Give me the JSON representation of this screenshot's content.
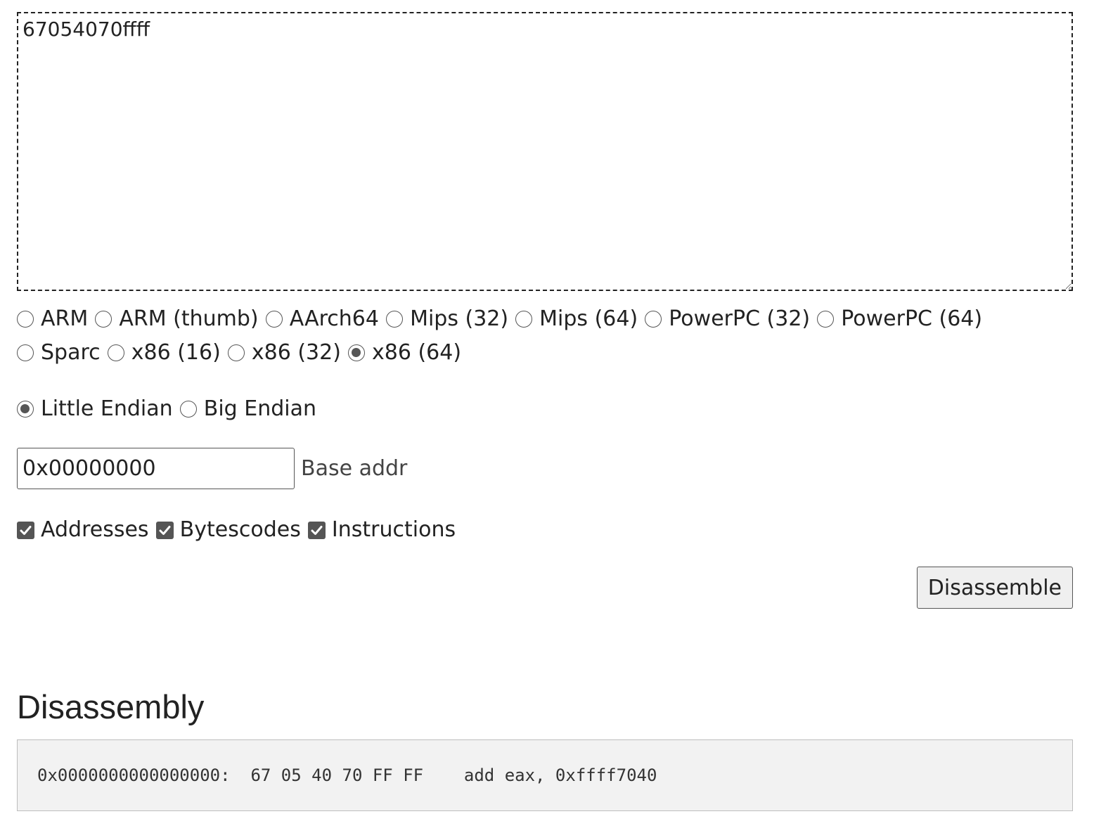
{
  "hex_input": {
    "value": "67054070ffff"
  },
  "architectures": [
    {
      "label": "ARM",
      "selected": false
    },
    {
      "label": "ARM (thumb)",
      "selected": false
    },
    {
      "label": "AArch64",
      "selected": false
    },
    {
      "label": "Mips (32)",
      "selected": false
    },
    {
      "label": "Mips (64)",
      "selected": false
    },
    {
      "label": "PowerPC (32)",
      "selected": false
    },
    {
      "label": "PowerPC (64)",
      "selected": false
    },
    {
      "label": "Sparc",
      "selected": false
    },
    {
      "label": "x86 (16)",
      "selected": false
    },
    {
      "label": "x86 (32)",
      "selected": false
    },
    {
      "label": "x86 (64)",
      "selected": true
    }
  ],
  "endianness": [
    {
      "label": "Little Endian",
      "selected": true
    },
    {
      "label": "Big Endian",
      "selected": false
    }
  ],
  "base_address": {
    "value": "0x00000000",
    "label": "Base addr"
  },
  "display_options": [
    {
      "label": "Addresses",
      "checked": true
    },
    {
      "label": "Bytescodes",
      "checked": true
    },
    {
      "label": "Instructions",
      "checked": true
    }
  ],
  "disassemble_button": {
    "label": "Disassemble"
  },
  "disassembly": {
    "heading": "Disassembly",
    "lines": [
      {
        "address": "0x0000000000000000:",
        "bytes": "67 05 40 70 FF FF",
        "instruction": "add eax, 0xffff7040"
      }
    ]
  },
  "colors": {
    "radio_selected": "#555555",
    "checkbox_fill": "#555555",
    "output_background": "#f2f2f2"
  }
}
